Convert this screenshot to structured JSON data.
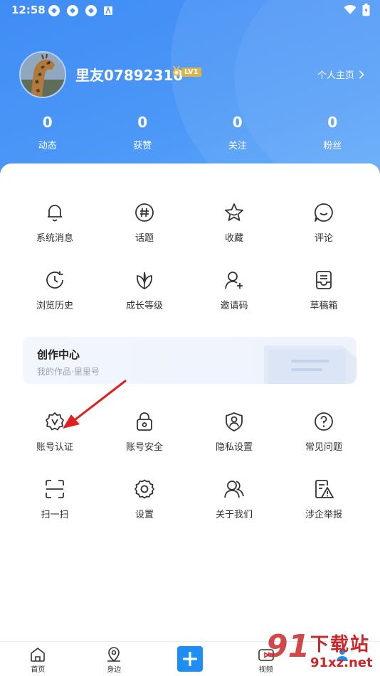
{
  "status": {
    "time": "12:58"
  },
  "profile": {
    "username": "里友07892310",
    "level": "LV1",
    "home_link": "个人主页"
  },
  "stats": [
    {
      "value": "0",
      "label": "动态"
    },
    {
      "value": "0",
      "label": "获赞"
    },
    {
      "value": "0",
      "label": "关注"
    },
    {
      "value": "0",
      "label": "粉丝"
    }
  ],
  "row1": [
    {
      "label": "系统消息",
      "icon": "bell-icon"
    },
    {
      "label": "话题",
      "icon": "hashtag-icon"
    },
    {
      "label": "收藏",
      "icon": "star-icon"
    },
    {
      "label": "评论",
      "icon": "comment-icon"
    }
  ],
  "row2": [
    {
      "label": "浏览历史",
      "icon": "history-icon"
    },
    {
      "label": "成长等级",
      "icon": "leaf-icon"
    },
    {
      "label": "邀请码",
      "icon": "invite-user-icon"
    },
    {
      "label": "草稿箱",
      "icon": "draft-box-icon"
    }
  ],
  "creation": {
    "title": "创作中心",
    "subtitle": "我的作品·里里号"
  },
  "row3": [
    {
      "label": "账号认证",
      "icon": "verified-badge-icon"
    },
    {
      "label": "账号安全",
      "icon": "lock-icon"
    },
    {
      "label": "隐私设置",
      "icon": "shield-user-icon"
    },
    {
      "label": "常见问题",
      "icon": "question-icon"
    }
  ],
  "row4": [
    {
      "label": "扫一扫",
      "icon": "scan-icon"
    },
    {
      "label": "设置",
      "icon": "gear-icon"
    },
    {
      "label": "关于我们",
      "icon": "users-icon"
    },
    {
      "label": "涉企举报",
      "icon": "report-icon"
    }
  ],
  "nav": [
    {
      "label": "首页",
      "icon": "home-icon"
    },
    {
      "label": "身边",
      "icon": "location-icon"
    },
    {
      "label": "",
      "icon": "plus-icon"
    },
    {
      "label": "视频",
      "icon": "video-icon"
    },
    {
      "label": "",
      "icon": "user-icon"
    }
  ],
  "watermark": {
    "logo": "91",
    "brand": "下载站",
    "domain": "91xz.net"
  },
  "colors": {
    "header": "#4b97f7",
    "accent": "#1e8ef6",
    "arrow": "#e02020"
  }
}
